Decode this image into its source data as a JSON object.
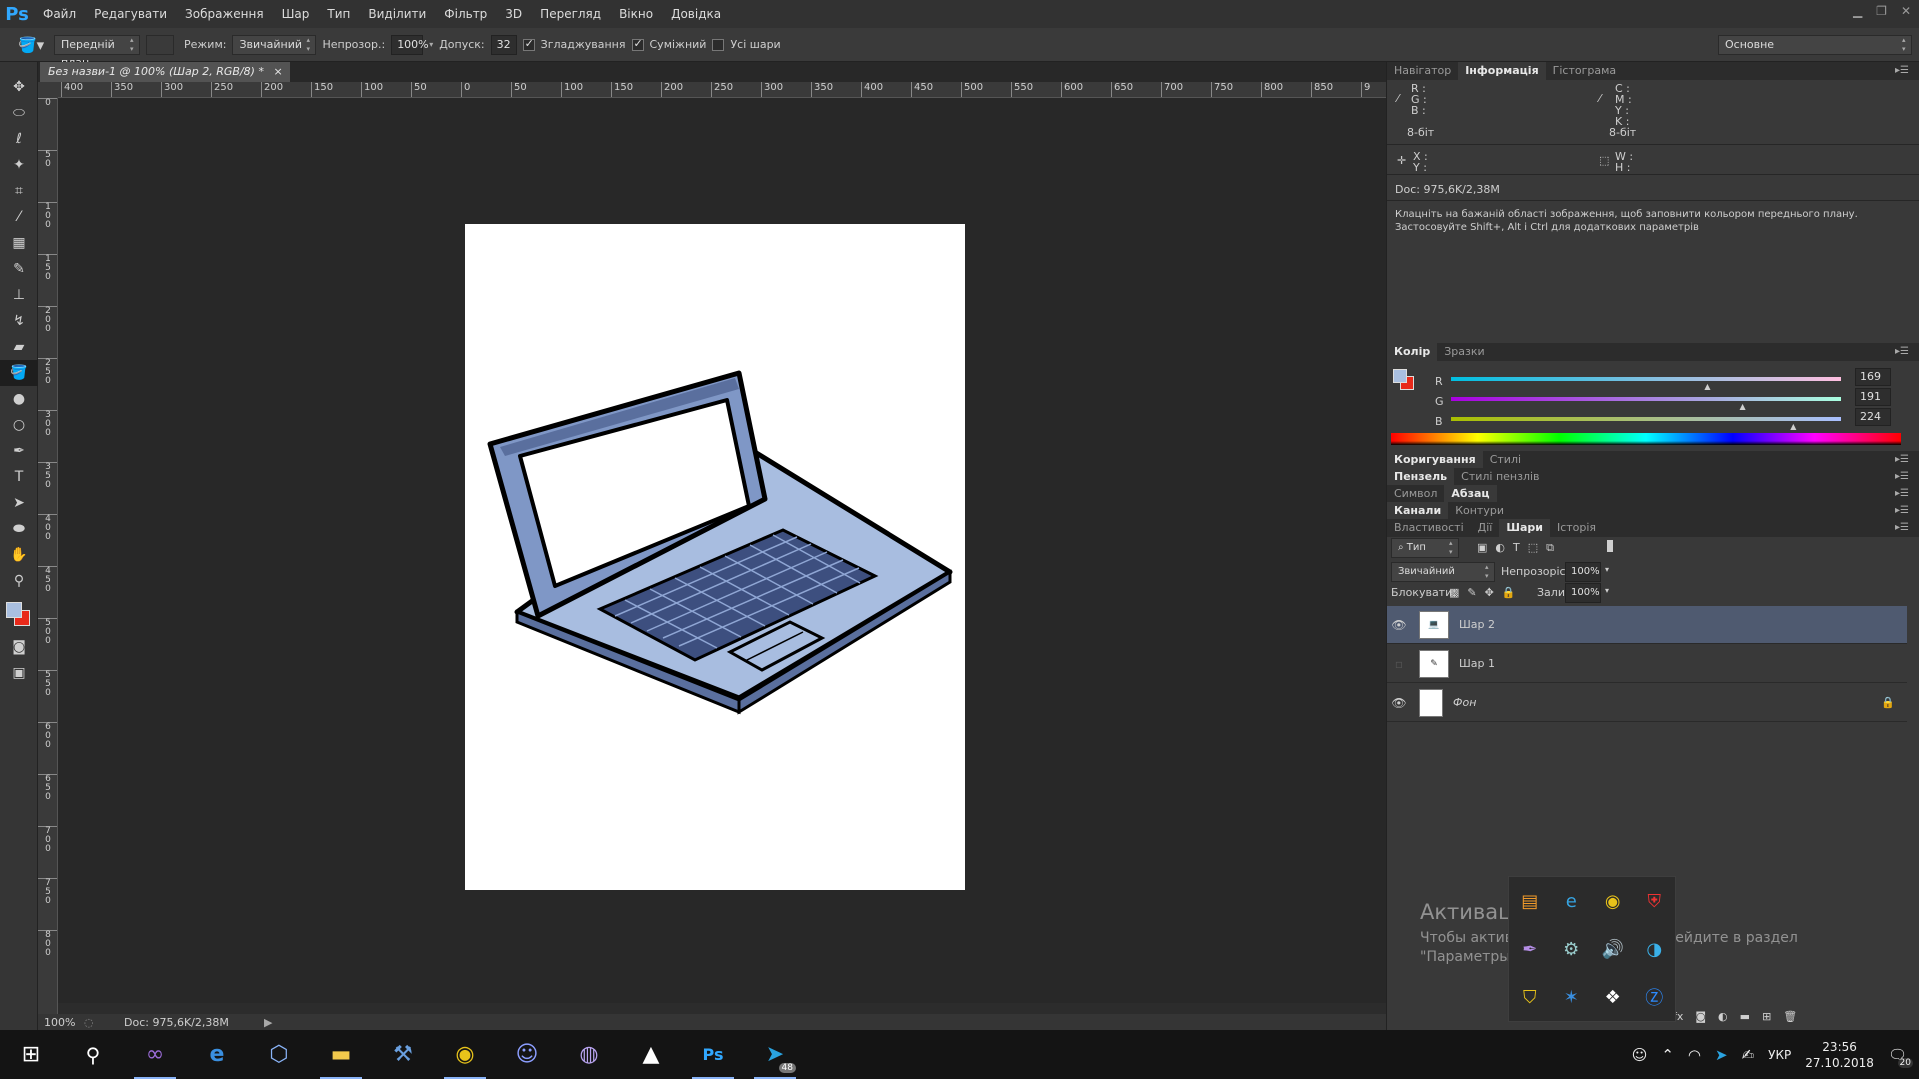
{
  "app": {
    "logo": "Ps",
    "accent": "#31a8ff"
  },
  "menu": [
    "Файл",
    "Редагувати",
    "Зображення",
    "Шар",
    "Тип",
    "Виділити",
    "Фільтр",
    "3D",
    "Перегляд",
    "Вікно",
    "Довідка"
  ],
  "window_controls": [
    "minimize-icon",
    "restore-icon",
    "close-icon"
  ],
  "options": {
    "fill_source": "Передній план",
    "mode_label": "Режим:",
    "mode_value": "Звичайний",
    "opacity_label": "Непрозор.:",
    "opacity_value": "100%",
    "tolerance_label": "Допуск:",
    "tolerance_value": "32",
    "antialias_label": "Згладжування",
    "antialias_checked": true,
    "contiguous_label": "Суміжний",
    "contiguous_checked": true,
    "all_layers_label": "Усі шари",
    "all_layers_checked": false,
    "workspace": "Основне"
  },
  "document": {
    "tab_title": "Без назви-1 @ 100% (Шар 2, RGB/8) *",
    "zoom": "100%",
    "doc_info": "Doc: 975,6K/2,38M"
  },
  "ruler_h": [
    "400",
    "350",
    "300",
    "250",
    "200",
    "150",
    "100",
    "50",
    "0",
    "50",
    "100",
    "150",
    "200",
    "250",
    "300",
    "350",
    "400",
    "450",
    "500",
    "550",
    "600",
    "650",
    "700",
    "750",
    "800",
    "850",
    "9"
  ],
  "ruler_v": [
    "0",
    "50",
    "100",
    "150",
    "200",
    "250",
    "300",
    "350",
    "400",
    "450",
    "500",
    "550",
    "600",
    "650",
    "700",
    "750",
    "800"
  ],
  "info_panel": {
    "tabs": [
      "Навігатор",
      "Інформація",
      "Гістограма"
    ],
    "active_tab": "Інформація",
    "rgb_labels": [
      "R :",
      "G :",
      "B :"
    ],
    "cmyk_labels": [
      "C :",
      "M :",
      "Y :",
      "K :"
    ],
    "bit_left": "8-біт",
    "bit_right": "8-біт",
    "xy_labels": [
      "X :",
      "Y :"
    ],
    "wh_labels": [
      "W :",
      "H :"
    ],
    "doc": "Doc: 975,6K/2,38M",
    "hint": "Клацніть на бажаній області зображення, щоб заповнити кольором переднього плану. Застосовуйте Shift+, Alt і Ctrl для додаткових параметрів"
  },
  "color_panel": {
    "tabs": [
      "Колір",
      "Зразки"
    ],
    "active_tab": "Колір",
    "channels": [
      {
        "label": "R",
        "value": "169",
        "fraction": 0.66
      },
      {
        "label": "G",
        "value": "191",
        "fraction": 0.75
      },
      {
        "label": "B",
        "value": "224",
        "fraction": 0.88
      }
    ],
    "foreground": "#a9bfe0",
    "background": "#e8291a"
  },
  "collapsed_panels": [
    {
      "tabs": [
        "Коригування",
        "Стилі"
      ],
      "active": "Коригування"
    },
    {
      "tabs": [
        "Пензель",
        "Стилі пензлів"
      ],
      "active": "Пензель"
    },
    {
      "tabs": [
        "Символ",
        "Абзац"
      ],
      "active": "Абзац"
    },
    {
      "tabs": [
        "Канали",
        "Контури"
      ],
      "active": "Канали"
    }
  ],
  "layers_panel": {
    "tabs": [
      "Властивості",
      "Дії",
      "Шари",
      "Історія"
    ],
    "active_tab": "Шари",
    "filter": "Тип",
    "blend": "Звичайний",
    "opacity_label": "Непрозорість:",
    "opacity": "100%",
    "lock_label": "Блокувати:",
    "fill_label": "Заливка:",
    "fill": "100%",
    "layers": [
      {
        "name": "Шар 2",
        "visible": true,
        "selected": true
      },
      {
        "name": "Шар 1",
        "visible": false,
        "selected": false
      },
      {
        "name": "Фон",
        "visible": true,
        "selected": false,
        "locked": true
      }
    ]
  },
  "watermark": {
    "title": "Активация Windows",
    "line1": "Чтобы активировать Windows, перейдите в раздел",
    "line2": "\"Параметры\"."
  },
  "taskbar": {
    "apps": [
      "start-icon",
      "search-icon",
      "visual-studio-icon",
      "edge-icon",
      "virtualbox-icon",
      "file-explorer-icon",
      "tools-icon",
      "chrome-icon",
      "discord-icon",
      "github-icon",
      "photos-icon",
      "photoshop-icon",
      "telegram-icon"
    ],
    "telegram_badge": "48",
    "lang": "УКР",
    "time": "23:56",
    "date": "27.10.2018",
    "notifications": "20"
  }
}
